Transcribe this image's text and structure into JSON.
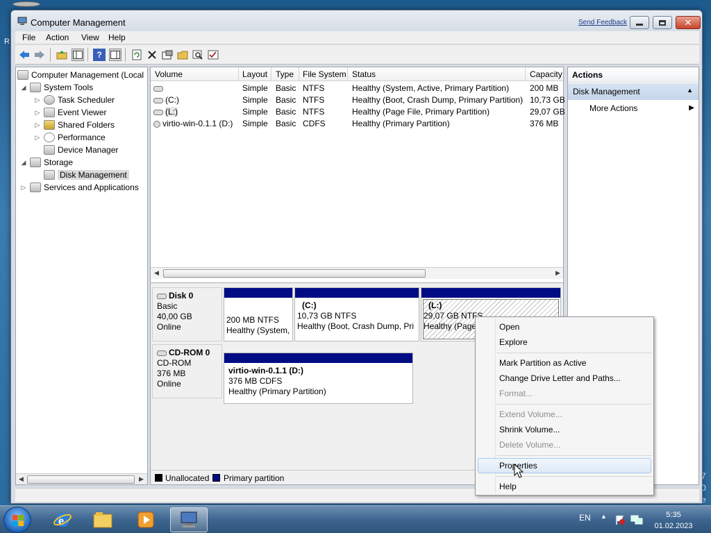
{
  "window": {
    "title": "Computer Management",
    "send_feedback": "Send Feedback",
    "close_label": "✕"
  },
  "menu": [
    "File",
    "Action",
    "View",
    "Help"
  ],
  "tree": [
    {
      "label": "Computer Management (Local",
      "indent": 0,
      "expander": ""
    },
    {
      "label": "System Tools",
      "indent": 1,
      "expander": "◢"
    },
    {
      "label": "Task Scheduler",
      "indent": 2,
      "expander": "▷"
    },
    {
      "label": "Event Viewer",
      "indent": 2,
      "expander": "▷"
    },
    {
      "label": "Shared Folders",
      "indent": 2,
      "expander": "▷"
    },
    {
      "label": "Performance",
      "indent": 2,
      "expander": "▷"
    },
    {
      "label": "Device Manager",
      "indent": 2,
      "expander": ""
    },
    {
      "label": "Storage",
      "indent": 1,
      "expander": "◢"
    },
    {
      "label": "Disk Management",
      "indent": 2,
      "expander": ""
    },
    {
      "label": "Services and Applications",
      "indent": 1,
      "expander": "▷"
    }
  ],
  "volumes": {
    "columns": [
      "Volume",
      "Layout",
      "Type",
      "File System",
      "Status",
      "Capacity"
    ],
    "rows": [
      [
        "",
        "Simple",
        "Basic",
        "NTFS",
        "Healthy (System, Active, Primary Partition)",
        "200 MB"
      ],
      [
        "(C:)",
        "Simple",
        "Basic",
        "NTFS",
        "Healthy (Boot, Crash Dump, Primary Partition)",
        "10,73 GB"
      ],
      [
        "(L:)",
        "Simple",
        "Basic",
        "NTFS",
        "Healthy (Page File, Primary Partition)",
        "29,07 GB"
      ],
      [
        "virtio-win-0.1.1 (D:)",
        "Simple",
        "Basic",
        "CDFS",
        "Healthy (Primary Partition)",
        "376 MB"
      ]
    ]
  },
  "disks": {
    "disk0": {
      "name": "Disk 0",
      "type": "Basic",
      "size": "40,00 GB",
      "state": "Online",
      "parts": [
        {
          "title": "",
          "size": "200 MB NTFS",
          "status": "Healthy (System,"
        },
        {
          "title": "(C:)",
          "size": "10,73 GB NTFS",
          "status": "Healthy (Boot, Crash Dump, Pri"
        },
        {
          "title": "(L:)",
          "size": "29,07 GB NTFS",
          "status": "Healthy (Page"
        }
      ]
    },
    "cdrom0": {
      "name": "CD-ROM 0",
      "type": "CD-ROM",
      "size": "376 MB",
      "state": "Online",
      "parts": [
        {
          "title": "virtio-win-0.1.1  (D:)",
          "size": "376 MB CDFS",
          "status": "Healthy (Primary Partition)"
        }
      ]
    }
  },
  "legend": {
    "unallocated": "Unallocated",
    "primary": "Primary partition"
  },
  "actions": {
    "header": "Actions",
    "section": "Disk Management",
    "more": "More Actions"
  },
  "context_menu": {
    "open": "Open",
    "explore": "Explore",
    "mark_active": "Mark Partition as Active",
    "change_letter": "Change Drive Letter and Paths...",
    "format": "Format...",
    "extend": "Extend Volume...",
    "shrink": "Shrink Volume...",
    "delete": "Delete Volume...",
    "properties": "Properties",
    "help": "Help"
  },
  "taskbar": {
    "language": "EN",
    "time": "5:35",
    "date": "01.02.2023"
  },
  "desktop": {
    "left_letters": "R",
    "right_letters": [
      "7",
      "0",
      "e"
    ]
  },
  "colors": {
    "primary_partition": "#000c84",
    "unallocated": "#000000",
    "selection": "#dadada"
  }
}
